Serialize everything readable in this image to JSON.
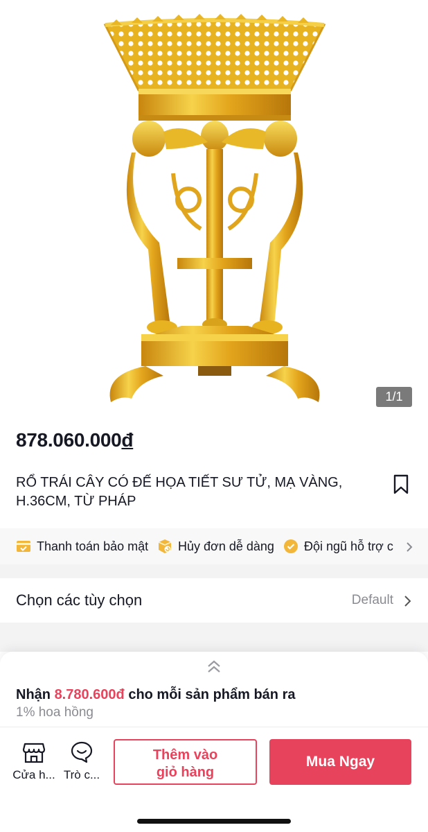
{
  "product": {
    "image_alt": "gold lion tripod fruit basket",
    "image_counter": "1/1",
    "price_amount": "878.060.000",
    "price_currency": "đ",
    "title": "RỔ TRÁI CÂY CÓ ĐẾ HỌA TIẾT SƯ TỬ, MẠ VÀNG, H.36CM, TỪ PHÁP"
  },
  "benefits": [
    {
      "icon": "card-check-icon",
      "label": "Thanh toán bảo mật"
    },
    {
      "icon": "box-refresh-icon",
      "label": "Hủy đơn dễ dàng"
    },
    {
      "icon": "badge-check-icon",
      "label": "Đội ngũ hỗ trợ c"
    }
  ],
  "options": {
    "label": "Chọn các tùy chọn",
    "value": "Default"
  },
  "commission": {
    "prefix": "Nhận ",
    "amount": "8.780.600đ",
    "suffix": " cho mỗi sản phẩm bán ra",
    "rate": "1% hoa hồng"
  },
  "bottom_bar": {
    "shop_label": "Cửa h...",
    "chat_label": "Trò c...",
    "cart_line1": "Thêm vào",
    "cart_line2": "giỏ hàng",
    "buy_label": "Mua Ngay"
  },
  "colors": {
    "accent": "#e8435c",
    "benefit_icon": "#f2b73a",
    "gold": "#e8b321"
  }
}
